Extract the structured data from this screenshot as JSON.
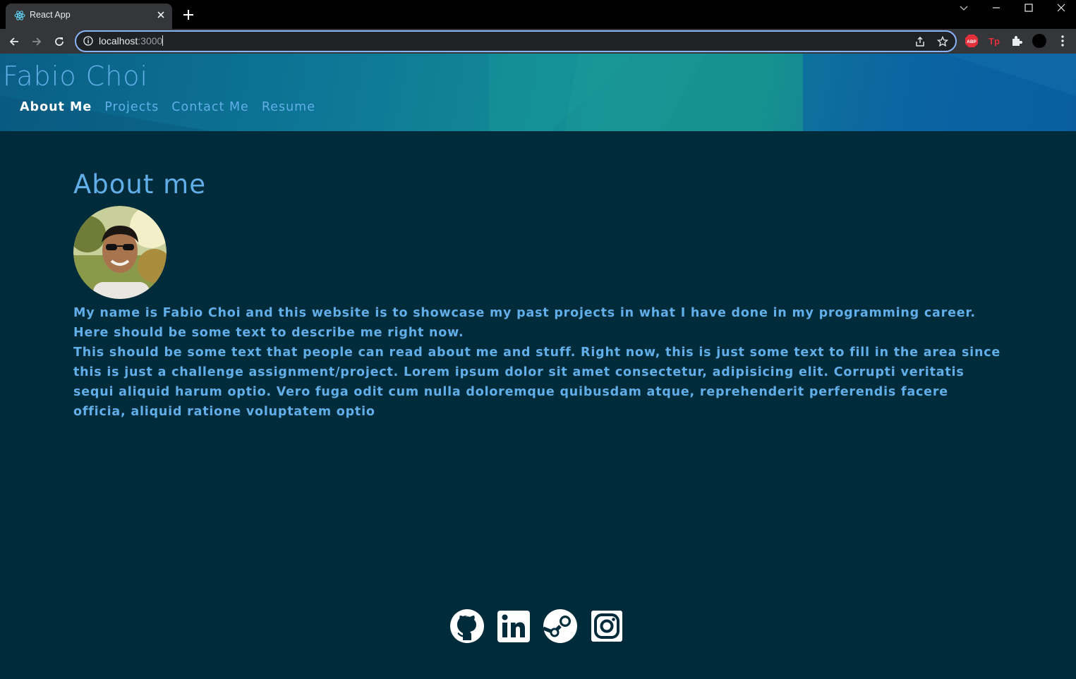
{
  "browser": {
    "tab_title": "React App",
    "url_host": "localhost",
    "url_port": ":3000"
  },
  "site": {
    "title": "Fabio Choi",
    "nav": [
      {
        "label": "About Me",
        "active": true
      },
      {
        "label": "Projects",
        "active": false
      },
      {
        "label": "Contact Me",
        "active": false
      },
      {
        "label": "Resume",
        "active": false
      }
    ]
  },
  "about": {
    "heading": "About me",
    "paragraph_1": "My name is Fabio Choi and this website is to showcase my past projects in what I have done in my programming career. Here should be some text to describe me right now.",
    "paragraph_2": "This should be some text that people can read about me and stuff. Right now, this is just some text to fill in the area since this is just a challenge assignment/project. Lorem ipsum dolor sit amet consectetur, adipisicing elit. Corrupti veritatis sequi aliquid harum optio. Vero fuga odit cum nulla doloremque quibusdam atque, reprehenderit perferendis facere officia, aliquid ratione voluptatem optio"
  },
  "footer": {
    "icons": [
      "github-icon",
      "linkedin-icon",
      "steam-icon",
      "instagram-icon"
    ]
  },
  "colors": {
    "page_bg": "#002b3b",
    "accent": "#61aee8",
    "active_nav": "#ffffff"
  }
}
